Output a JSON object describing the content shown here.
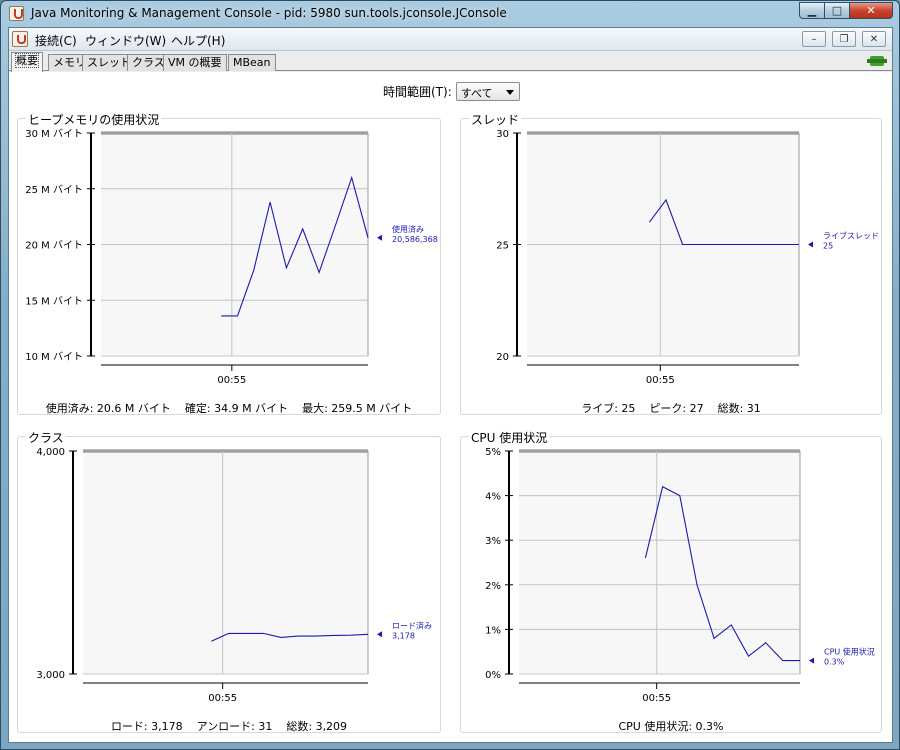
{
  "window": {
    "title": "Java Monitoring & Management Console - pid: 5980 sun.tools.jconsole.JConsole",
    "controls": {
      "minimize": "▁",
      "maximize": "□",
      "close": "✕"
    }
  },
  "menubar": {
    "items": [
      {
        "label": "接続(C)"
      },
      {
        "label": "ウィンドウ(W)"
      },
      {
        "label": "ヘルプ(H)"
      }
    ],
    "mdi_controls": {
      "minimize": "–",
      "restore": "❐",
      "close": "✕"
    }
  },
  "tabs": [
    {
      "label": "概要",
      "active": true
    },
    {
      "label": "メモリ"
    },
    {
      "label": "スレッド"
    },
    {
      "label": "クラス"
    },
    {
      "label": "VM の概要"
    },
    {
      "label": "MBean"
    }
  ],
  "time_range": {
    "label": "時間範囲(T):",
    "value": "すべて"
  },
  "colors": {
    "series": "#1a1ab0",
    "grid": "#c4c4c4",
    "plot_bg": "#f7f7f7"
  },
  "panels": {
    "heap": {
      "title": "ヒープメモリの使用状況",
      "summary": "使用済み: 20.6 M バイト    確定: 34.9 M バイト    最大: 259.5 M バイト"
    },
    "threads": {
      "title": "スレッド",
      "summary": "ライブ: 25    ピーク: 27    総数: 31"
    },
    "classes": {
      "title": "クラス",
      "summary": "ロード: 3,178    アンロード: 31    総数: 3,209"
    },
    "cpu": {
      "title": "CPU 使用状況",
      "summary": "CPU 使用状況: 0.3%"
    }
  },
  "chart_data": [
    {
      "id": "heap",
      "type": "line",
      "ylim": [
        10,
        30
      ],
      "yticks": [
        10,
        15,
        20,
        25,
        30
      ],
      "ytick_labels": [
        "10 M バイト",
        "15 M バイト",
        "20 M バイト",
        "25 M バイト",
        "30 M バイト"
      ],
      "xtick_label": "00:55",
      "series": [
        {
          "name": "使用済み",
          "value_label": "20,586,368",
          "x": [
            0,
            1,
            2,
            3,
            4,
            5,
            6,
            7,
            8,
            9
          ],
          "y": [
            13.6,
            13.6,
            17.7,
            23.8,
            17.9,
            21.4,
            17.5,
            21.7,
            26,
            20.6
          ]
        }
      ]
    },
    {
      "id": "threads",
      "type": "line",
      "ylim": [
        20,
        30
      ],
      "yticks": [
        20,
        25,
        30
      ],
      "ytick_labels": [
        "20",
        "25",
        "30"
      ],
      "xtick_label": "00:55",
      "series": [
        {
          "name": "ライブスレッド",
          "value_label": "25",
          "x": [
            0,
            1,
            2,
            3,
            4,
            5,
            6,
            7,
            8,
            9
          ],
          "y": [
            26,
            27,
            25,
            25,
            25,
            25,
            25,
            25,
            25,
            25
          ]
        }
      ]
    },
    {
      "id": "classes",
      "type": "line",
      "ylim": [
        3000,
        4000
      ],
      "yticks": [
        3000,
        4000
      ],
      "ytick_labels": [
        "3,000",
        "4,000"
      ],
      "xtick_label": "00:55",
      "series": [
        {
          "name": "ロード済み",
          "value_label": "3,178",
          "x": [
            0,
            1,
            2,
            3,
            4,
            5,
            6,
            7,
            8,
            9
          ],
          "y": [
            3147,
            3182,
            3182,
            3182,
            3164,
            3170,
            3170,
            3173,
            3174,
            3178
          ]
        }
      ]
    },
    {
      "id": "cpu",
      "type": "line",
      "ylim": [
        0,
        5
      ],
      "yticks": [
        0,
        1,
        2,
        3,
        4,
        5
      ],
      "ytick_labels": [
        "0%",
        "1%",
        "2%",
        "3%",
        "4%",
        "5%"
      ],
      "xtick_label": "00:55",
      "series": [
        {
          "name": "CPU 使用状況",
          "value_label": "0.3%",
          "x": [
            0,
            1,
            2,
            3,
            4,
            5,
            6,
            7,
            8,
            9
          ],
          "y": [
            2.6,
            4.2,
            4.0,
            2.0,
            0.8,
            1.1,
            0.4,
            0.7,
            0.3,
            0.3
          ]
        }
      ]
    }
  ]
}
